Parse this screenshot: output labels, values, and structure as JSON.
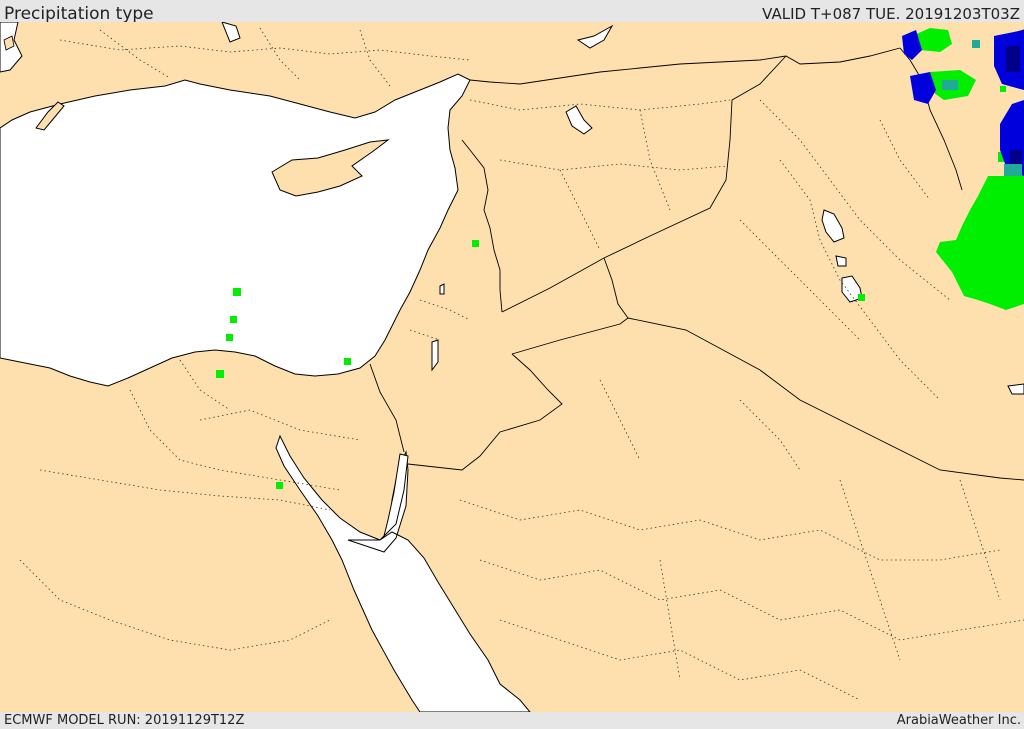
{
  "header": {
    "title": "Precipitation type",
    "valid": "VALID T+087 TUE. 20191203T03Z"
  },
  "footer": {
    "model_run": "ECMWF MODEL RUN: 20191129T12Z",
    "credit": "ArabiaWeather Inc."
  },
  "map": {
    "colors": {
      "land": "#fde0ae",
      "water": "#ffffff",
      "rain": "#00ee00",
      "snow": "#0000dd",
      "wet_snow": "#22aa99",
      "heavy_snow": "#000088",
      "border": "#000000"
    },
    "legend_visible": false
  }
}
